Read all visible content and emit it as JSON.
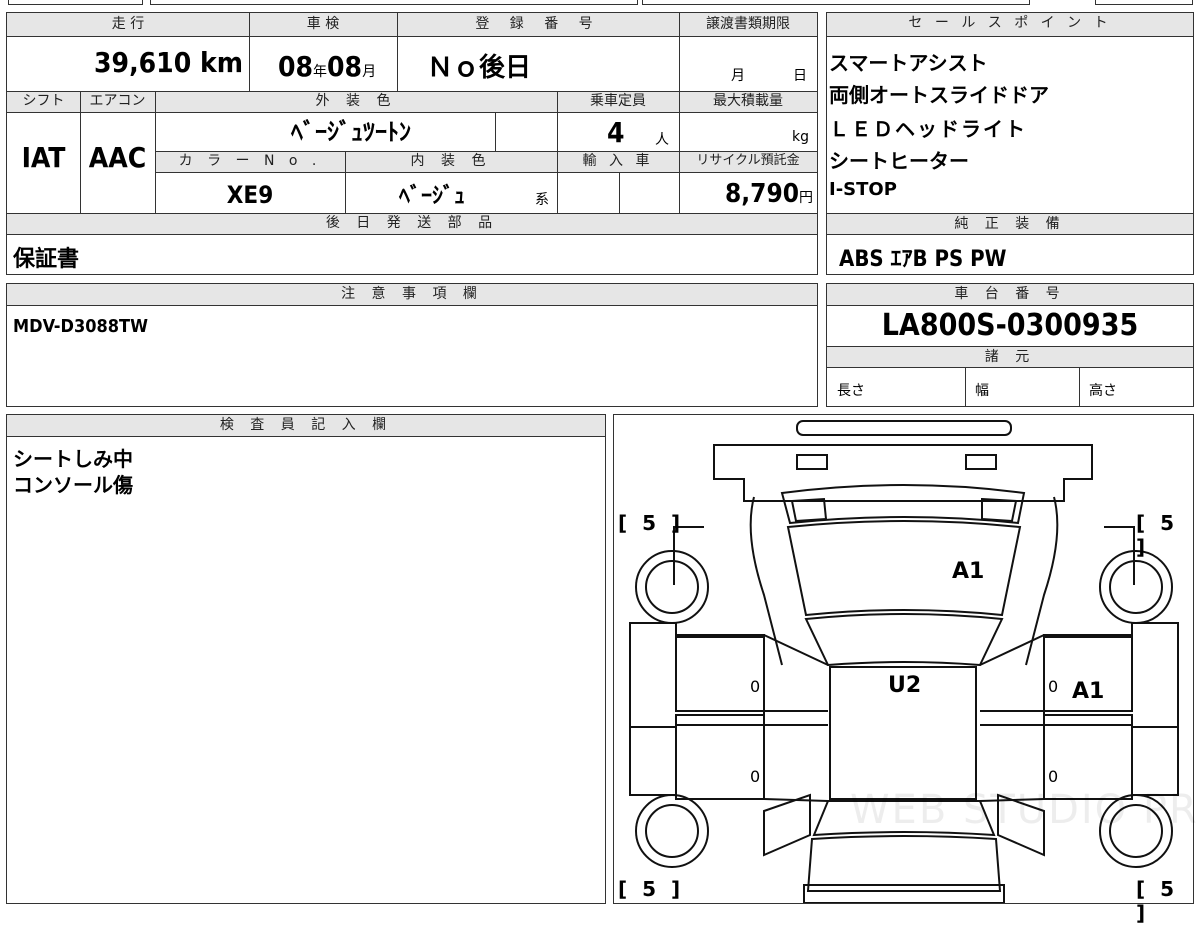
{
  "labels": {
    "mileage": "走 行",
    "inspection": "車 検",
    "registration_no": "登 録 番 号",
    "transfer_deadline": "譲渡書類期限",
    "sales_points": "セ ー ル ス ポ イ ン ト",
    "shift": "シフト",
    "aircon": "エアコン",
    "exterior_color": "外 装 色",
    "capacity": "乗車定員",
    "max_load": "最大積載量",
    "color_no": "カ ラ ー N o .",
    "interior_color": "内 装 色",
    "import": "輸 入 車",
    "recycle_fee": "リサイクル預託金",
    "later_parts": "後 日 発 送 部 品",
    "standard_equipment": "純 正 装 備",
    "notes": "注 意 事 項 欄",
    "chassis_no": "車 台 番 号",
    "specs": "諸 元",
    "length": "長さ",
    "width": "幅",
    "height": "高さ",
    "inspector": "検 査 員 記 入 欄"
  },
  "values": {
    "mileage": "39,610",
    "mileage_unit": "km",
    "inspection_year": "08",
    "inspection_year_unit": "年",
    "inspection_month": "08",
    "inspection_month_unit": "月",
    "registration": "Ｎｏ後日",
    "deadline_month": "月",
    "deadline_day": "日",
    "shift": "IAT",
    "aircon": "AAC",
    "exterior_color": "ﾍﾞｰｼﾞｭﾂｰﾄﾝ",
    "capacity": "4",
    "capacity_unit": "人",
    "max_load_unit": "kg",
    "color_no": "XE9",
    "interior_color": "ﾍﾞｰｼﾞｭ",
    "interior_suffix": "系",
    "recycle_fee": "8,790",
    "recycle_unit": "円",
    "later_parts": "保証書",
    "notes": "MDV-D3088TW",
    "chassis_no": "LA800S-0300935",
    "standard_equipment": "ABS ｴｱB PS PW"
  },
  "sales_points": [
    "スマートアシスト",
    "両側オートスライドドア",
    "ＬＥＤヘッドライト",
    "シートヒーター",
    "I-STOP"
  ],
  "inspector_notes": [
    "シートしみ中",
    "コンソール傷"
  ],
  "diagram": {
    "corner_tl": "[ 5 ]",
    "corner_tr": "[ 5 ]",
    "corner_bl": "[ 5 ]",
    "corner_br": "[ 5 ]",
    "mark_hood": "A1",
    "mark_roof": "U2",
    "mark_right_door": "A1",
    "zero_lf": "0",
    "zero_rf": "0",
    "zero_lr": "0",
    "zero_rr": "0",
    "watermark": "WEB STUDIO PRO"
  }
}
